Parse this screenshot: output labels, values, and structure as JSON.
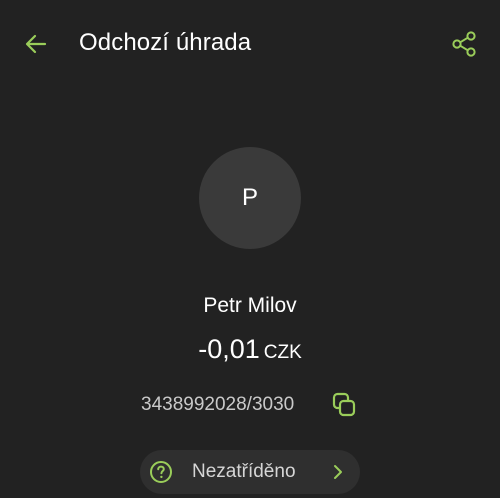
{
  "colors": {
    "background": "#222222",
    "accent": "#9acd5a",
    "avatar_bg": "#3a3a3a",
    "chip_bg": "#2f2f2f"
  },
  "header": {
    "back_icon": "arrow-left-icon",
    "title": "Odchozí úhrada",
    "share_icon": "share-icon"
  },
  "counterparty": {
    "initial": "P",
    "name": "Petr Milov"
  },
  "amount": {
    "value": "-0,01",
    "currency": "CZK"
  },
  "account": {
    "number": "3438992028/3030",
    "copy_icon": "copy-icon"
  },
  "category": {
    "icon": "question-circle-icon",
    "label": "Nezatříděno",
    "chevron_icon": "chevron-right-icon"
  }
}
